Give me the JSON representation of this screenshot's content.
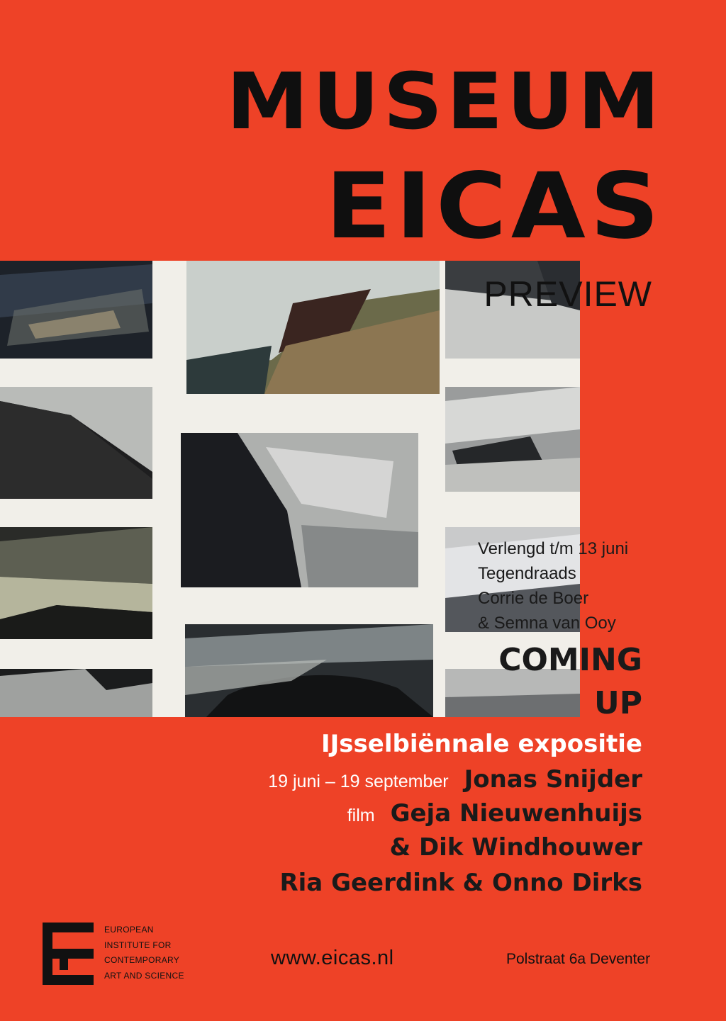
{
  "header": {
    "title_line1": "MUSEUM",
    "title_line2": "EICAS",
    "subtitle": "PREVIEW"
  },
  "current_exhibition": {
    "lines": [
      "Verlengd t/m 13 juni",
      "Tegendraads",
      "Corrie de Boer",
      "& Semna van Ooy"
    ]
  },
  "coming_up": {
    "heading_line1": "COMING",
    "heading_line2": "UP",
    "event_title": "IJsselbiënnale expositie",
    "dates": "19 juni – 19 september",
    "artist1": "Jonas Snijder",
    "film_label": "film",
    "film_artists_line1": "Geja Nieuwenhuijs",
    "film_artists_line2": "& Dik Windhouwer",
    "artist_pair": "Ria Geerdink & Onno Dirks"
  },
  "footer": {
    "org_lines": [
      "EUROPEAN",
      "INSTITUTE FOR",
      "CONTEMPORARY",
      "ART AND SCIENCE"
    ],
    "website": "www.eicas.nl",
    "address": "Polstraat 6a Deventer"
  },
  "colors": {
    "background": "#ee4227",
    "text": "#111111",
    "accent_white": "#ffffff"
  }
}
